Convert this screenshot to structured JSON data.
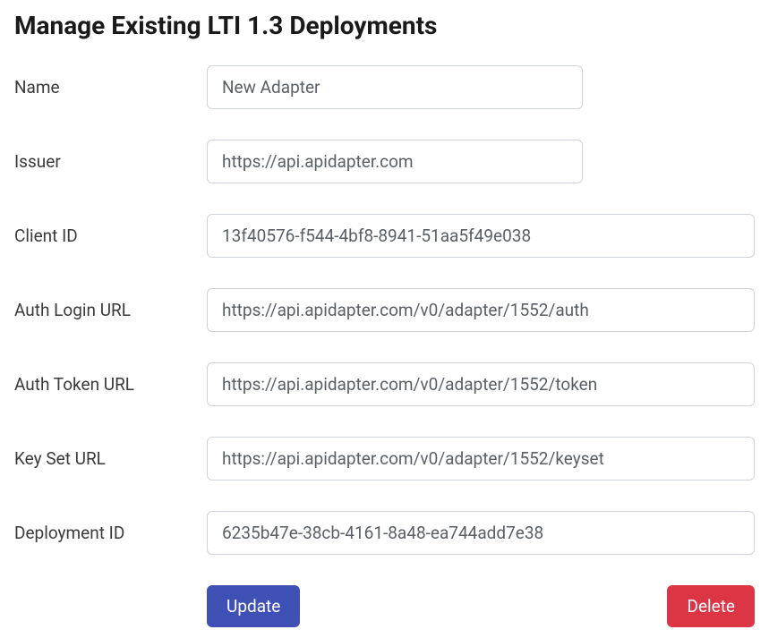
{
  "title": "Manage Existing LTI 1.3 Deployments",
  "form": {
    "name": {
      "label": "Name",
      "value": "New Adapter"
    },
    "issuer": {
      "label": "Issuer",
      "value": "https://api.apidapter.com"
    },
    "clientId": {
      "label": "Client ID",
      "value": "13f40576-f544-4bf8-8941-51aa5f49e038"
    },
    "authLoginUrl": {
      "label": "Auth Login URL",
      "value": "https://api.apidapter.com/v0/adapter/1552/auth"
    },
    "authTokenUrl": {
      "label": "Auth Token URL",
      "value": "https://api.apidapter.com/v0/adapter/1552/token"
    },
    "keySetUrl": {
      "label": "Key Set URL",
      "value": "https://api.apidapter.com/v0/adapter/1552/keyset"
    },
    "deploymentId": {
      "label": "Deployment ID",
      "value": "6235b47e-38cb-4161-8a48-ea744add7e38"
    }
  },
  "buttons": {
    "update": "Update",
    "delete": "Delete"
  }
}
